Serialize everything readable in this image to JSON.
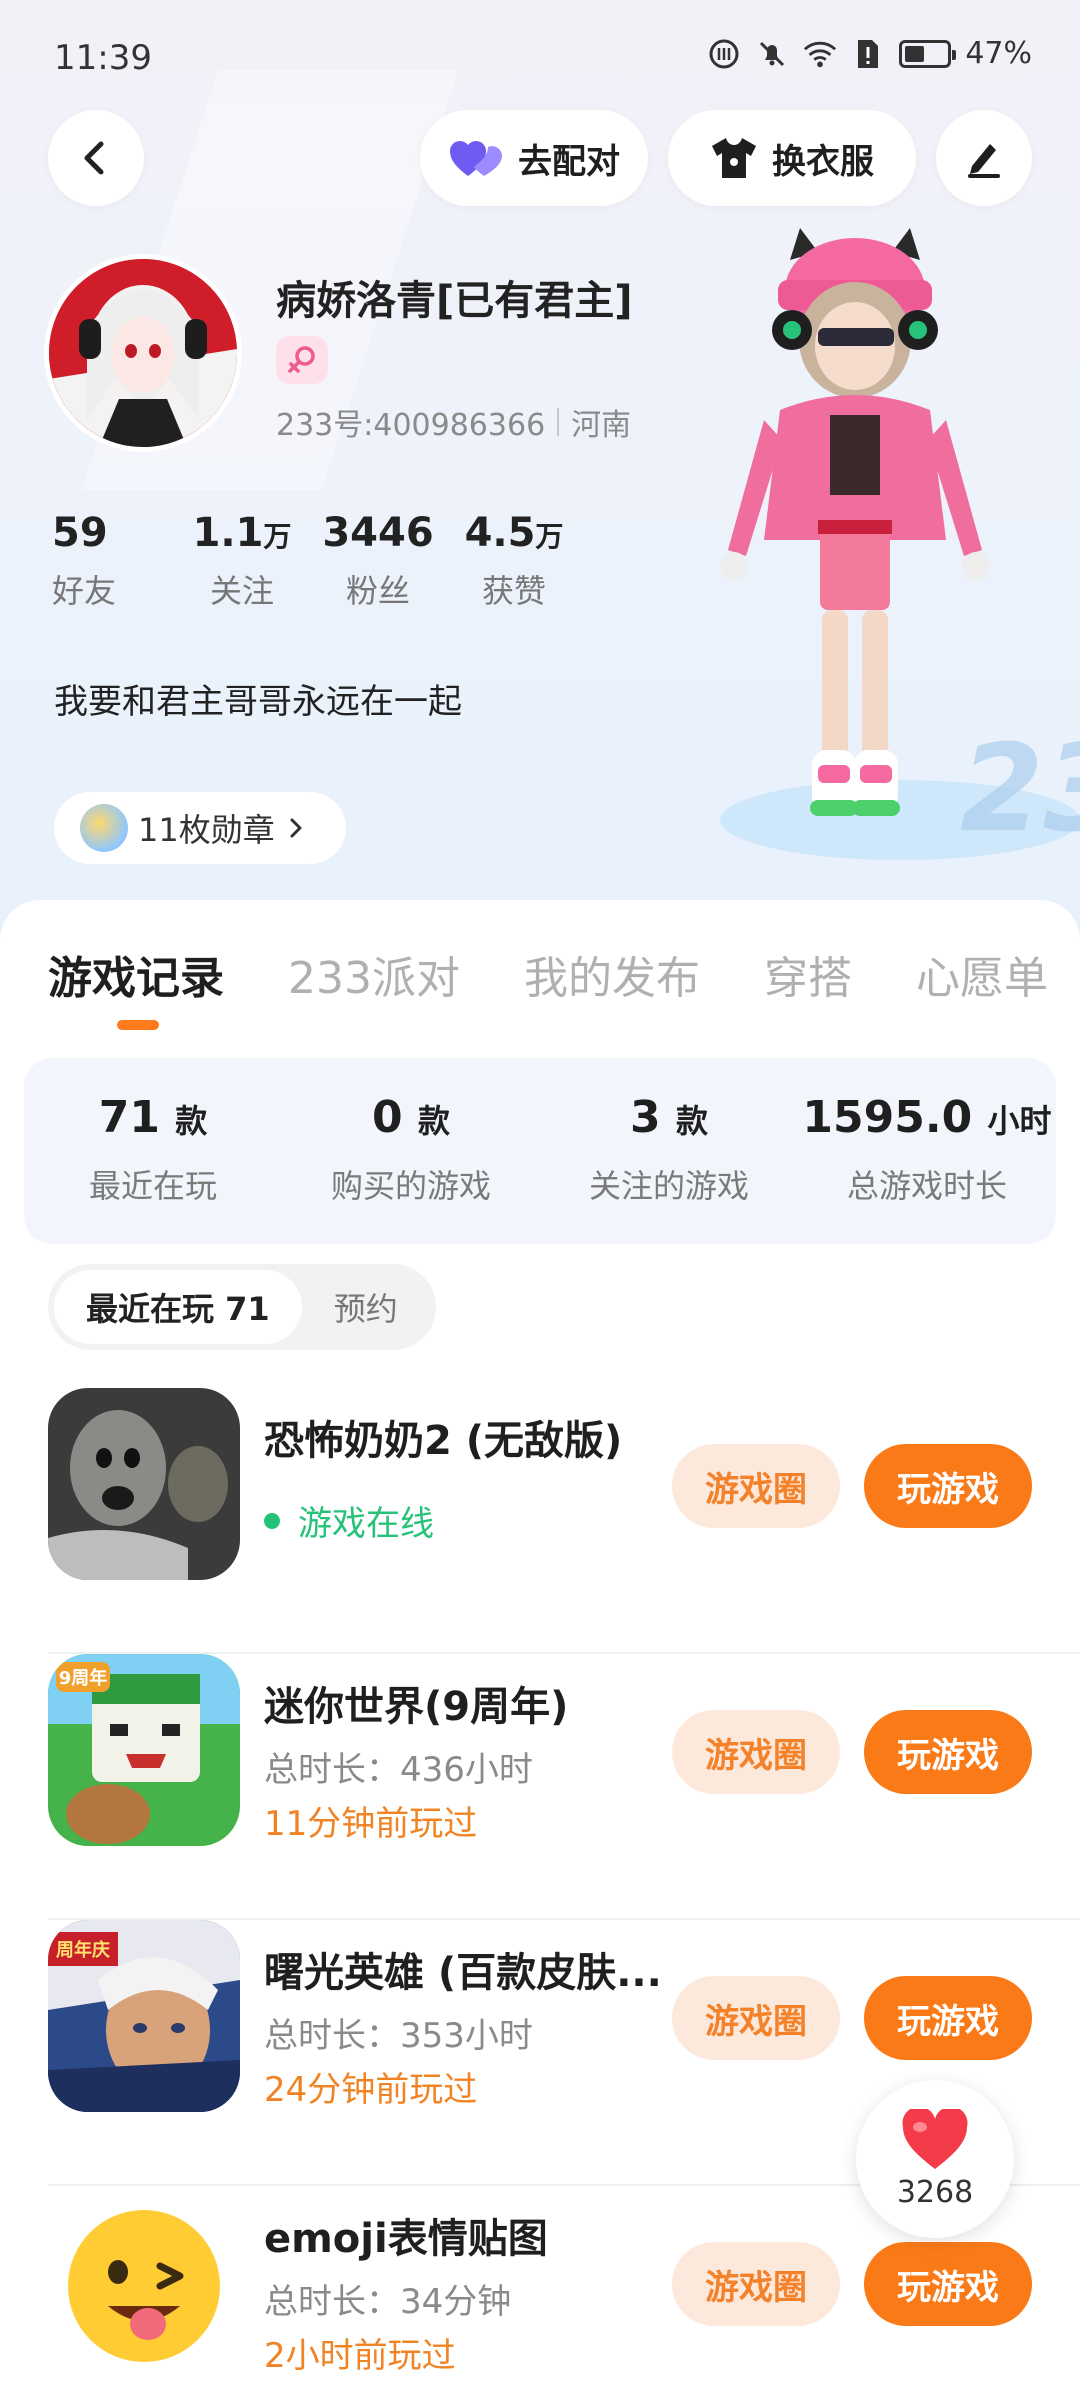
{
  "status_bar": {
    "time": "11:39",
    "battery": "47%",
    "battery_level": 0.47
  },
  "header": {
    "pair_label": "去配对",
    "dress_label": "换衣服"
  },
  "profile": {
    "username": "病娇洛青[已有君主]",
    "account_id": "233号:400986366",
    "location": "河南",
    "bio": "我要和君主哥哥永远在一起",
    "stats": [
      {
        "value": "59",
        "unit": "",
        "label": "好友"
      },
      {
        "value": "1.1",
        "unit": "万",
        "label": "关注"
      },
      {
        "value": "3446",
        "unit": "",
        "label": "粉丝"
      },
      {
        "value": "4.5",
        "unit": "万",
        "label": "获赞"
      }
    ],
    "medals_label": "11枚勋章"
  },
  "tabs": [
    {
      "label": "游戏记录",
      "active": true
    },
    {
      "label": "233派对",
      "active": false
    },
    {
      "label": "我的发布",
      "active": false
    },
    {
      "label": "穿搭",
      "active": false
    },
    {
      "label": "心愿单",
      "active": false
    }
  ],
  "summary": [
    {
      "value": "71",
      "unit": "款",
      "label": "最近在玩"
    },
    {
      "value": "0",
      "unit": "款",
      "label": "购买的游戏"
    },
    {
      "value": "3",
      "unit": "款",
      "label": "关注的游戏"
    },
    {
      "value": "1595.0",
      "unit": "小时",
      "label": "总游戏时长"
    }
  ],
  "filters": [
    {
      "label": "最近在玩 71",
      "active": true
    },
    {
      "label": "预约",
      "active": false
    }
  ],
  "games": [
    {
      "title": "恐怖奶奶2 (无敌版)",
      "status": "游戏在线",
      "circle_label": "游戏圈",
      "play_label": "玩游戏"
    },
    {
      "title": "迷你世界(9周年)",
      "duration": "总时长：436小时",
      "last_played": "11分钟前玩过",
      "circle_label": "游戏圈",
      "play_label": "玩游戏"
    },
    {
      "title": "曙光英雄 (百款皮肤...",
      "duration": "总时长：353小时",
      "last_played": "24分钟前玩过",
      "circle_label": "游戏圈",
      "play_label": "玩游戏"
    },
    {
      "title": "emoji表情贴图",
      "duration": "总时长：34分钟",
      "last_played": "2小时前玩过",
      "circle_label": "游戏圈",
      "play_label": "玩游戏"
    }
  ],
  "like_fab": {
    "count": "3268"
  },
  "icon_text": {
    "mini_world_badge": "9周年",
    "shuguang_badge": "周年庆",
    "watermark_233": "233"
  },
  "colors": {
    "accent": "#fb7a18",
    "accent_soft": "#fde9dc",
    "online": "#27c27a",
    "recent": "#f08424"
  }
}
